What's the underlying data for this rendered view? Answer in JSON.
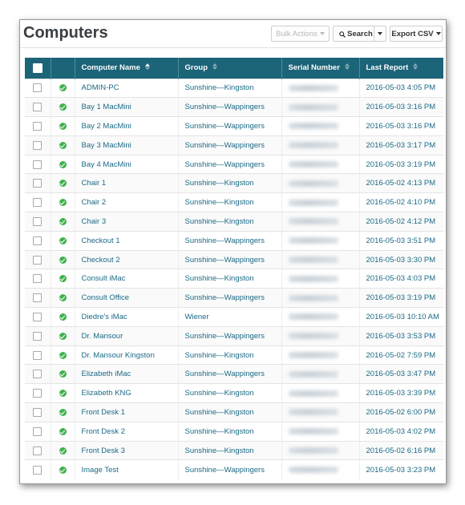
{
  "page": {
    "title": "Computers"
  },
  "toolbar": {
    "bulk_actions_label": "Bulk Actions",
    "search_label": "Search",
    "export_label": "Export CSV"
  },
  "table": {
    "columns": {
      "name": "Computer Name",
      "group": "Group",
      "serial": "Serial Number",
      "last_report": "Last Report"
    },
    "sort_column": "Computer Name",
    "rows": [
      {
        "name": "ADMIN-PC",
        "group": "Sunshine—Kingston",
        "last_report": "2016-05-03 4:05 PM",
        "status": "ok"
      },
      {
        "name": "Bay 1 MacMini",
        "group": "Sunshine—Wappingers",
        "last_report": "2016-05-03 3:16 PM",
        "status": "ok"
      },
      {
        "name": "Bay 2 MacMini",
        "group": "Sunshine—Wappingers",
        "last_report": "2016-05-03 3:16 PM",
        "status": "ok"
      },
      {
        "name": "Bay 3 MacMini",
        "group": "Sunshine—Wappingers",
        "last_report": "2016-05-03 3:17 PM",
        "status": "ok"
      },
      {
        "name": "Bay 4 MacMini",
        "group": "Sunshine—Wappingers",
        "last_report": "2016-05-03 3:19 PM",
        "status": "ok"
      },
      {
        "name": "Chair 1",
        "group": "Sunshine—Kingston",
        "last_report": "2016-05-02 4:13 PM",
        "status": "ok"
      },
      {
        "name": "Chair 2",
        "group": "Sunshine—Kingston",
        "last_report": "2016-05-02 4:10 PM",
        "status": "ok"
      },
      {
        "name": "Chair 3",
        "group": "Sunshine—Kingston",
        "last_report": "2016-05-02 4:12 PM",
        "status": "ok"
      },
      {
        "name": "Checkout 1",
        "group": "Sunshine—Wappingers",
        "last_report": "2016-05-03 3:51 PM",
        "status": "ok"
      },
      {
        "name": "Checkout 2",
        "group": "Sunshine—Wappingers",
        "last_report": "2016-05-03 3:30 PM",
        "status": "ok"
      },
      {
        "name": "Consult iMac",
        "group": "Sunshine—Kingston",
        "last_report": "2016-05-03 4:03 PM",
        "status": "ok"
      },
      {
        "name": "Consult Office",
        "group": "Sunshine—Wappingers",
        "last_report": "2016-05-03 3:19 PM",
        "status": "ok"
      },
      {
        "name": "Diedre's iMac",
        "group": "Wiener",
        "last_report": "2016-05-03 10:10 AM",
        "status": "ok"
      },
      {
        "name": "Dr. Mansour",
        "group": "Sunshine—Wappingers",
        "last_report": "2016-05-03 3:53 PM",
        "status": "ok"
      },
      {
        "name": "Dr. Mansour Kingston",
        "group": "Sunshine—Kingston",
        "last_report": "2016-05-02 7:59 PM",
        "status": "ok"
      },
      {
        "name": "Elizabeth iMac",
        "group": "Sunshine—Wappingers",
        "last_report": "2016-05-03 3:47 PM",
        "status": "ok"
      },
      {
        "name": "Elizabeth KNG",
        "group": "Sunshine—Kingston",
        "last_report": "2016-05-03 3:39 PM",
        "status": "ok"
      },
      {
        "name": "Front Desk 1",
        "group": "Sunshine—Kingston",
        "last_report": "2016-05-02 6:00 PM",
        "status": "ok"
      },
      {
        "name": "Front Desk 2",
        "group": "Sunshine—Kingston",
        "last_report": "2016-05-03 4:02 PM",
        "status": "ok"
      },
      {
        "name": "Front Desk 3",
        "group": "Sunshine—Kingston",
        "last_report": "2016-05-02 6:16 PM",
        "status": "ok"
      },
      {
        "name": "Image Test",
        "group": "Sunshine—Wappingers",
        "last_report": "2016-05-03 3:23 PM",
        "status": "ok"
      }
    ]
  },
  "colors": {
    "header_bg": "#1c6478",
    "link": "#1b6a86",
    "status_ok": "#3fb24c"
  },
  "icons": {
    "status": "check-circle-icon",
    "search": "search-icon",
    "sort": "sort-icon"
  }
}
